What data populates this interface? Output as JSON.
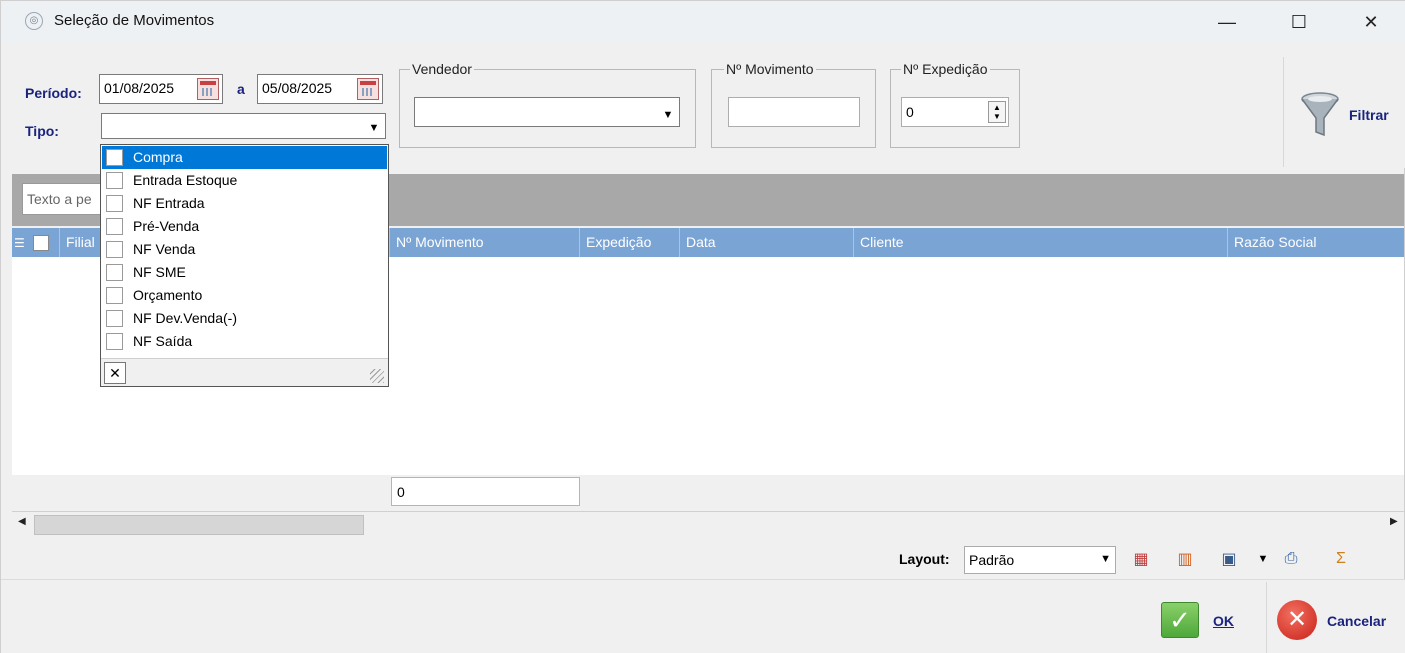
{
  "window": {
    "title": "Seleção de Movimentos",
    "minimize": "—",
    "maximize": "☐",
    "close": "✕"
  },
  "filters": {
    "periodo_label": "Período:",
    "date_from": "01/08/2025",
    "date_sep": "a",
    "date_to": "05/08/2025",
    "tipo_label": "Tipo:",
    "tipo_value": "",
    "vendedor_label": "Vendedor",
    "vendedor_value": "",
    "movimento_label": "Nº Movimento",
    "movimento_value": "",
    "expedicao_label": "Nº Expedição",
    "expedicao_value": "0",
    "filtrar_label": "Filtrar"
  },
  "tipo_dropdown": {
    "items": [
      {
        "label": "Compra",
        "selected": true
      },
      {
        "label": "Entrada Estoque",
        "selected": false
      },
      {
        "label": "NF Entrada",
        "selected": false
      },
      {
        "label": "Pré-Venda",
        "selected": false
      },
      {
        "label": "NF Venda",
        "selected": false
      },
      {
        "label": "NF SME",
        "selected": false
      },
      {
        "label": "Orçamento",
        "selected": false
      },
      {
        "label": "NF Dev.Venda(-)",
        "selected": false
      },
      {
        "label": "NF Saída",
        "selected": false
      }
    ],
    "close_symbol": "✕"
  },
  "search": {
    "placeholder": "Texto a pe"
  },
  "grid": {
    "columns": [
      "Filial",
      "Nº Movimento",
      "Expedição",
      "Data",
      "Cliente",
      "Razão Social"
    ],
    "footer_count": "0"
  },
  "layout": {
    "label": "Layout:",
    "value": "Padrão"
  },
  "buttons": {
    "ok": "OK",
    "cancel": "Cancelar"
  },
  "colors": {
    "header_bg": "#7aa4d4",
    "label_blue": "#1a237e",
    "selection": "#0078d7",
    "search_bar": "#a8a8a8"
  }
}
